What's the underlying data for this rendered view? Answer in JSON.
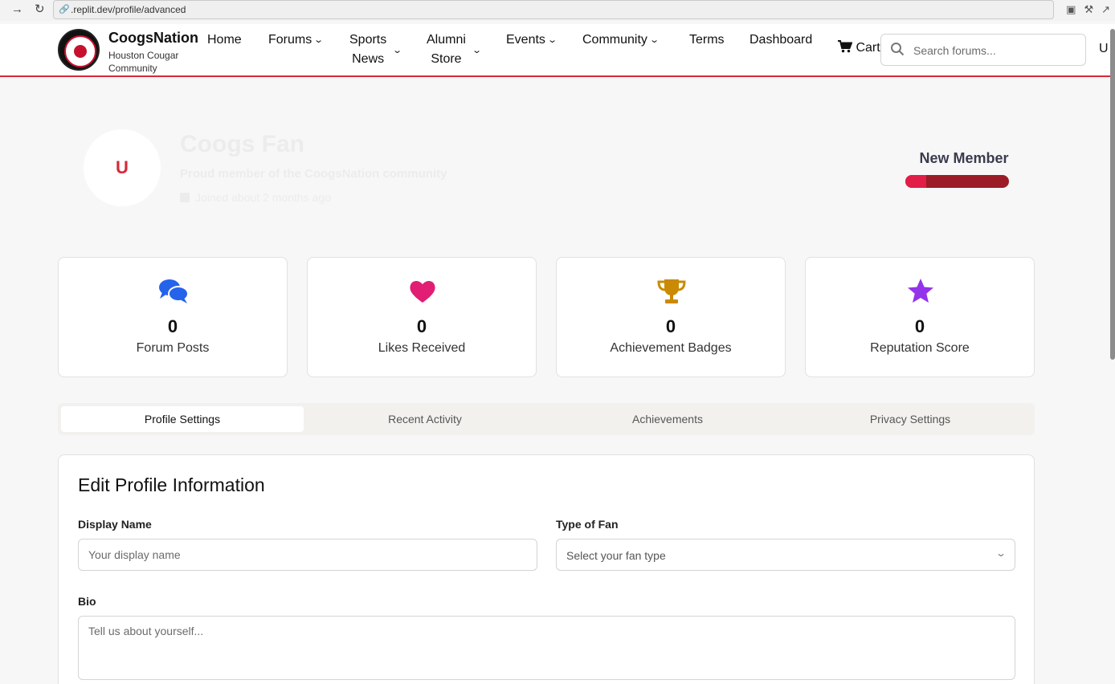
{
  "browser": {
    "url": ".replit.dev/profile/advanced"
  },
  "header": {
    "brand_name": "CoogsNation",
    "brand_tagline": "Houston Cougar Community",
    "nav": {
      "home": "Home",
      "forums": "Forums",
      "sports_news_line1": "Sports",
      "sports_news_line2": "News",
      "alumni_store_line1": "Alumni",
      "alumni_store_line2": "Store",
      "events": "Events",
      "community": "Community",
      "terms": "Terms",
      "dashboard": "Dashboard"
    },
    "cart_label": "Cart",
    "search_placeholder": "Search forums...",
    "user_initial": "U"
  },
  "profile": {
    "avatar_initial": "U",
    "name": "Coogs Fan",
    "bio": "Proud member of the CoogsNation community",
    "joined": "Joined about 2 months ago",
    "member_level": "New Member",
    "level_progress": 0.2
  },
  "stats": [
    {
      "icon": "comments-icon",
      "value": "0",
      "label": "Forum Posts",
      "color": "#2563eb"
    },
    {
      "icon": "heart-icon",
      "value": "0",
      "label": "Likes Received",
      "color": "#e11d74"
    },
    {
      "icon": "trophy-icon",
      "value": "0",
      "label": "Achievement Badges",
      "color": "#ca8a04"
    },
    {
      "icon": "star-icon",
      "value": "0",
      "label": "Reputation Score",
      "color": "#9333ea"
    }
  ],
  "tabs": {
    "profile_settings": "Profile Settings",
    "recent_activity": "Recent Activity",
    "achievements": "Achievements",
    "privacy_settings": "Privacy Settings",
    "active": "profile_settings"
  },
  "edit_form": {
    "title": "Edit Profile Information",
    "display_name_label": "Display Name",
    "display_name_placeholder": "Your display name",
    "fan_type_label": "Type of Fan",
    "fan_type_placeholder": "Select your fan type",
    "bio_label": "Bio",
    "bio_placeholder": "Tell us about yourself..."
  },
  "colors": {
    "accent": "#d8283a",
    "progress_fill": "#e11d48",
    "progress_track": "#9b1c26"
  }
}
